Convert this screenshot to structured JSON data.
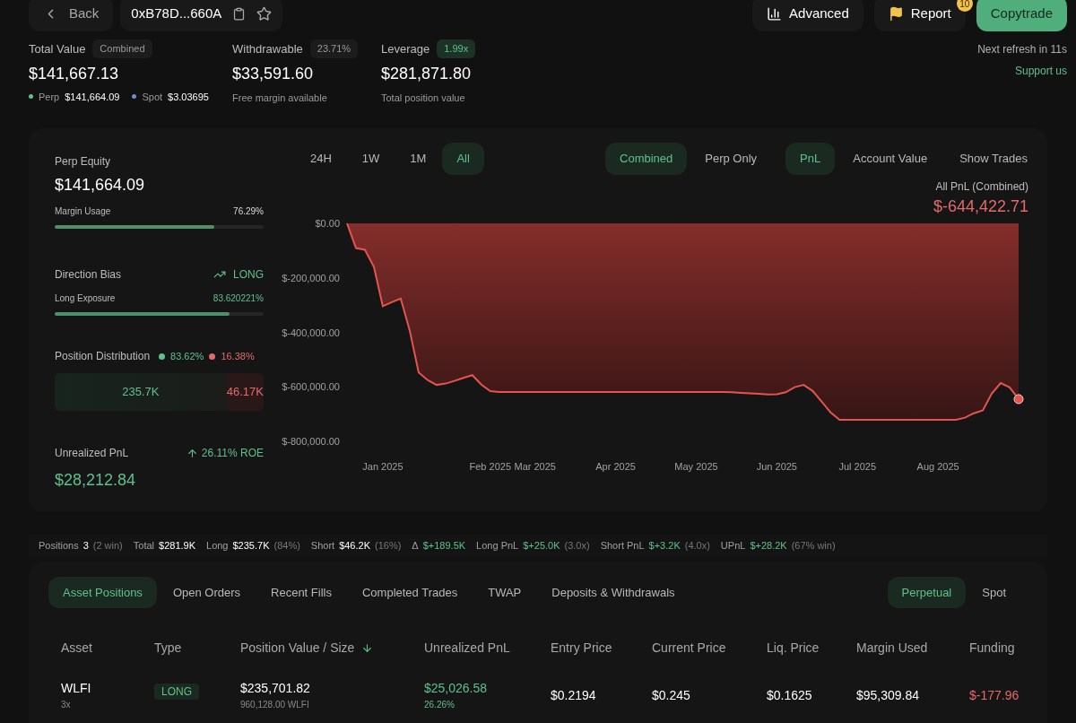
{
  "top_bar": {
    "back": "Back",
    "address": "0xB78D...660A",
    "actions": [
      {
        "kind": "chart",
        "label": "Advanced"
      },
      {
        "kind": "flag",
        "label": "Report",
        "badge": "10"
      },
      {
        "kind": "primary",
        "label": "Copytrade"
      }
    ]
  },
  "stats": [
    {
      "label": "Total Value",
      "tag": "Combined",
      "kind": "plain",
      "value": "$141,667.13",
      "parts": [
        {
          "label": "Perp",
          "value": "$141,664.09",
          "color": "#5fc08c"
        },
        {
          "label": "Spot",
          "value": "$3.03695",
          "color": "#6b8fc9"
        }
      ]
    },
    {
      "label": "Withdrawable",
      "tag": "23.71%",
      "kind": "plain",
      "value": "$33,591.60",
      "note": "Free margin available"
    },
    {
      "label": "Leverage",
      "tag": "1.99x",
      "kind": "positive",
      "value": "$281,871.80",
      "note": "Total position value"
    }
  ],
  "refresh": {
    "text": "Next refresh in 11s",
    "link": "Support us"
  },
  "equity": {
    "label": "Perp Equity",
    "value": "$141,664.09",
    "bar_label": "Margin Usage",
    "bar_value": "76.29%",
    "level": 0.7629
  },
  "bias": {
    "label": "Direction Bias",
    "direction": "LONG",
    "bar_label": "Long Exposure",
    "bar_value": "83.620221%",
    "level": 0.8362
  },
  "distribution": {
    "label": "Position Distribution",
    "long_pct": "83.62%",
    "short_pct": "16.38%",
    "long_value": "235.7K",
    "short_value": "46.17K",
    "level": 0.8362
  },
  "unrealized": {
    "label": "Unrealized PnL",
    "roe": "26.11% ROE",
    "value": "$28,212.84"
  },
  "ranges": [
    {
      "label": "24H",
      "selected": false
    },
    {
      "label": "1W",
      "selected": false
    },
    {
      "label": "1M",
      "selected": false
    },
    {
      "label": "All",
      "selected": true
    }
  ],
  "scopes": [
    {
      "label": "Combined",
      "selected": true
    },
    {
      "label": "Perp Only",
      "selected": false
    }
  ],
  "metrics": [
    {
      "label": "PnL",
      "selected": true
    },
    {
      "label": "Account Value",
      "selected": false
    }
  ],
  "show_trades": "Show Trades",
  "chart_title": "All PnL (Combined)",
  "chart_total": "$-644,422.71",
  "chart": {
    "chart_data": {
      "type": "area",
      "ylim": [
        -800000,
        0
      ],
      "yticks": [
        {
          "value": 0,
          "label": "$0.00"
        },
        {
          "value": -200000,
          "label": "$-200,000.00"
        },
        {
          "value": -400000,
          "label": "$-400,000.00"
        },
        {
          "value": -600000,
          "label": "$-600,000.00"
        },
        {
          "value": -800000,
          "label": "$-800,000.00"
        }
      ],
      "categories": [
        null,
        null,
        null,
        null,
        "Jan 2025",
        null,
        null,
        null,
        null,
        null,
        null,
        null,
        null,
        null,
        null,
        null,
        "Feb 2025",
        null,
        null,
        null,
        null,
        "Mar 2025",
        null,
        null,
        null,
        null,
        null,
        null,
        null,
        null,
        "Apr 2025",
        null,
        null,
        null,
        null,
        null,
        null,
        null,
        null,
        "May 2025",
        null,
        null,
        null,
        null,
        null,
        null,
        null,
        null,
        "Jun 2025",
        null,
        null,
        null,
        null,
        null,
        null,
        null,
        null,
        "Jul 2025",
        null,
        null,
        null,
        null,
        null,
        null,
        null,
        null,
        "Aug 2025",
        null,
        null,
        null,
        null,
        null,
        null,
        null,
        null,
        null
      ],
      "series": [
        {
          "color": "#e5544f",
          "values": [
            0,
            -91000,
            -97000,
            -160000,
            -304000,
            -289000,
            -276000,
            -393000,
            -547000,
            -575000,
            -593000,
            -588000,
            -578000,
            -567000,
            -557000,
            -592000,
            -616000,
            -619000,
            -619000,
            -619000,
            -619000,
            -619000,
            -619000,
            -619000,
            -619000,
            -619000,
            -619000,
            -619000,
            -619000,
            -619000,
            -619000,
            -619000,
            -619000,
            -619000,
            -619000,
            -619000,
            -619000,
            -619000,
            -619000,
            -619000,
            -619000,
            -619000,
            -619000,
            -620000,
            -622000,
            -624000,
            -626000,
            -628000,
            -627000,
            -620000,
            -601000,
            -593000,
            -615000,
            -654000,
            -694000,
            -721000,
            -721000,
            -721000,
            -721000,
            -721000,
            -721000,
            -721000,
            -721000,
            -721000,
            -721000,
            -721000,
            -721000,
            -721000,
            -721000,
            -713000,
            -697000,
            -686000,
            -625000,
            -586000,
            -602000,
            -645000
          ]
        }
      ]
    }
  },
  "summary": [
    {
      "label": "Positions",
      "value": "3",
      "note": "(2 win)",
      "kind": "plain"
    },
    {
      "label": "Total",
      "value": "$281.9K",
      "kind": "plain"
    },
    {
      "label": "Long",
      "value": "$235.7K",
      "note": "(84%)",
      "kind": "plain"
    },
    {
      "label": "Short",
      "value": "$46.2K",
      "note": "(16%)",
      "kind": "plain"
    },
    {
      "label": "Δ",
      "value": "$+189.5K",
      "kind": "positive"
    },
    {
      "label": "Long PnL",
      "value": "$+25.0K",
      "note": "(3.0x)",
      "kind": "positive"
    },
    {
      "label": "Short PnL",
      "value": "$+3.2K",
      "note": "(4.0x)",
      "kind": "positive"
    },
    {
      "label": "UPnL",
      "value": "$+28.2K",
      "note": "(67% win)",
      "kind": "positive"
    }
  ],
  "tabs": [
    {
      "label": "Asset Positions",
      "selected": true
    },
    {
      "label": "Open Orders",
      "selected": false
    },
    {
      "label": "Recent Fills",
      "selected": false
    },
    {
      "label": "Completed Trades",
      "selected": false
    },
    {
      "label": "TWAP",
      "selected": false
    },
    {
      "label": "Deposits & Withdrawals",
      "selected": false
    }
  ],
  "markets": [
    {
      "label": "Perpetual",
      "selected": true
    },
    {
      "label": "Spot",
      "selected": false
    }
  ],
  "table": {
    "columns": [
      {
        "label": "Asset",
        "sorted": false
      },
      {
        "label": "Type",
        "sorted": false
      },
      {
        "label": "Position Value / Size",
        "sorted": true
      },
      {
        "label": "Unrealized PnL",
        "sorted": false
      },
      {
        "label": "Entry Price",
        "sorted": false
      },
      {
        "label": "Current Price",
        "sorted": false
      },
      {
        "label": "Liq. Price",
        "sorted": false
      },
      {
        "label": "Margin Used",
        "sorted": false
      },
      {
        "label": "Funding",
        "sorted": false
      }
    ],
    "rows": [
      {
        "asset": "WLFI",
        "leverage": "3x",
        "type": "LONG",
        "kind": "long",
        "value": "$235,701.82",
        "size": "960,128.00 WLFI",
        "pnl": {
          "text": "$25,026.58",
          "kind": "positive"
        },
        "pnl_pct": "26.26%",
        "entry": "$0.2194",
        "current": "$0.245",
        "liq": "$0.1625",
        "margin": "$95,309.84",
        "funding": {
          "text": "$-177.96",
          "kind": "negative"
        }
      }
    ]
  }
}
